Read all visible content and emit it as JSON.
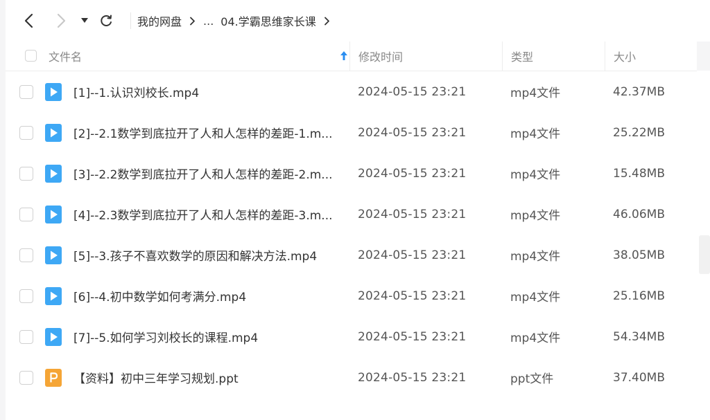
{
  "toolbar": {
    "breadcrumb": {
      "root": "我的网盘",
      "ellipsis": "...",
      "current": "04.学霸思维家长课"
    }
  },
  "header": {
    "name": "文件名",
    "modified": "修改时间",
    "type": "类型",
    "size": "大小"
  },
  "colors": {
    "video_icon": "#3ea8f5",
    "ppt_icon": "#f5a536",
    "sort_arrow": "#2a8df0"
  },
  "files": [
    {
      "name": "[1]--1.认识刘校长.mp4",
      "modified": "2024-05-15 23:21",
      "type": "mp4文件",
      "size": "42.37MB",
      "icon": "video-file-icon"
    },
    {
      "name": "[2]--2.1数学到底拉开了人和人怎样的差距-1.m...",
      "modified": "2024-05-15 23:21",
      "type": "mp4文件",
      "size": "25.22MB",
      "icon": "video-file-icon"
    },
    {
      "name": "[3]--2.2数学到底拉开了人和人怎样的差距-2.m...",
      "modified": "2024-05-15 23:21",
      "type": "mp4文件",
      "size": "15.48MB",
      "icon": "video-file-icon"
    },
    {
      "name": "[4]--2.3数学到底拉开了人和人怎样的差距-3.m...",
      "modified": "2024-05-15 23:21",
      "type": "mp4文件",
      "size": "46.06MB",
      "icon": "video-file-icon"
    },
    {
      "name": "[5]--3.孩子不喜欢数学的原因和解决方法.mp4",
      "modified": "2024-05-15 23:21",
      "type": "mp4文件",
      "size": "38.05MB",
      "icon": "video-file-icon"
    },
    {
      "name": "[6]--4.初中数学如何考满分.mp4",
      "modified": "2024-05-15 23:21",
      "type": "mp4文件",
      "size": "25.16MB",
      "icon": "video-file-icon"
    },
    {
      "name": "[7]--5.如何学习刘校长的课程.mp4",
      "modified": "2024-05-15 23:21",
      "type": "mp4文件",
      "size": "54.34MB",
      "icon": "video-file-icon"
    },
    {
      "name": "【资料】初中三年学习规划.ppt",
      "modified": "2024-05-15 23:21",
      "type": "ppt文件",
      "size": "37.40MB",
      "icon": "ppt-file-icon"
    }
  ]
}
